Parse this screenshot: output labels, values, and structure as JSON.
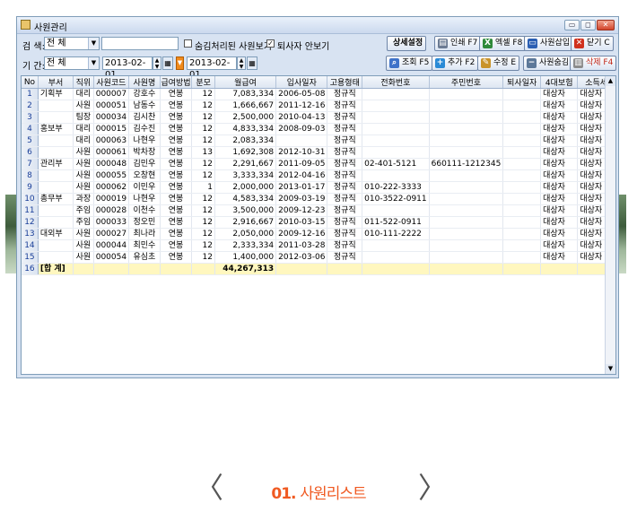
{
  "window": {
    "title": "사원관리",
    "minimize_glyph": "▭",
    "restore_glyph": "◻",
    "close_glyph": "✕"
  },
  "search": {
    "search_label": "검 색:",
    "search_scope": "전      체",
    "search_value": "",
    "retired_checkbox_label": "숨김처리된 사원보기",
    "retired_checked": false,
    "hide_quit_label": "퇴사자 안보기",
    "hide_quit_checked": true,
    "period_label": "기 간:",
    "period_scope": "전      체",
    "date_from": "2013-02-01",
    "date_to": "2013-02-01"
  },
  "toolbar": {
    "detail_settings": "상세설정",
    "print": "인쇄 F7",
    "excel": "엑셀 F8",
    "employee_register": "사원삽입",
    "close": "닫기 C",
    "query": "조회 F5",
    "add": "추가 F2",
    "edit": "수정 E",
    "employee_hide": "사원숨김",
    "delete": "삭제 F4"
  },
  "icons": {
    "print": "printer-icon",
    "excel": "excel-icon",
    "register": "user-icon",
    "close": "x-icon",
    "query": "magnifier-icon",
    "add": "plus-icon",
    "edit": "pencil-icon",
    "hide": "minus-icon",
    "delete": "trash-icon"
  },
  "colors": {
    "accent": "#f05a22",
    "total_row": "#fff7bf",
    "row_number": "#1a3f99"
  },
  "grid": {
    "columns": [
      "No",
      "부서",
      "직위",
      "사원코드",
      "사원명",
      "급여방법",
      "분모",
      "월급여",
      "입사일자",
      "고용형태",
      "전화번호",
      "주민번호",
      "퇴사일자",
      "4대보험",
      "소득세"
    ],
    "rows": [
      [
        "1",
        "기획부",
        "대리",
        "000007",
        "강호수",
        "연봉",
        "12",
        "7,083,334",
        "2006-05-08",
        "정규직",
        "",
        "",
        "",
        "대상자",
        "대상자"
      ],
      [
        "2",
        "",
        "사원",
        "000051",
        "남동수",
        "연봉",
        "12",
        "1,666,667",
        "2011-12-16",
        "정규직",
        "",
        "",
        "",
        "대상자",
        "대상자"
      ],
      [
        "3",
        "",
        "팀장",
        "000034",
        "김시찬",
        "연봉",
        "12",
        "2,500,000",
        "2010-04-13",
        "정규직",
        "",
        "",
        "",
        "대상자",
        "대상자"
      ],
      [
        "4",
        "홍보부",
        "대리",
        "000015",
        "김수진",
        "연봉",
        "12",
        "4,833,334",
        "2008-09-03",
        "정규직",
        "",
        "",
        "",
        "대상자",
        "대상자"
      ],
      [
        "5",
        "",
        "대리",
        "000063",
        "나현우",
        "연봉",
        "12",
        "2,083,334",
        "",
        "정규직",
        "",
        "",
        "",
        "대상자",
        "대상자"
      ],
      [
        "6",
        "",
        "사원",
        "000061",
        "박차장",
        "연봉",
        "13",
        "1,692,308",
        "2012-10-31",
        "정규직",
        "",
        "",
        "",
        "대상자",
        "대상자"
      ],
      [
        "7",
        "관리부",
        "사원",
        "000048",
        "김민우",
        "연봉",
        "12",
        "2,291,667",
        "2011-09-05",
        "정규직",
        "02-401-5121",
        "660111-1212345",
        "",
        "대상자",
        "대상자"
      ],
      [
        "8",
        "",
        "사원",
        "000055",
        "오창현",
        "연봉",
        "12",
        "3,333,334",
        "2012-04-16",
        "정규직",
        "",
        "",
        "",
        "대상자",
        "대상자"
      ],
      [
        "9",
        "",
        "사원",
        "000062",
        "이민우",
        "연봉",
        "1",
        "2,000,000",
        "2013-01-17",
        "정규직",
        "010-222-3333",
        "",
        "",
        "대상자",
        "대상자"
      ],
      [
        "10",
        "총무부",
        "과장",
        "000019",
        "나현우",
        "연봉",
        "12",
        "4,583,334",
        "2009-03-19",
        "정규직",
        "010-3522-0911",
        "",
        "",
        "대상자",
        "대상자"
      ],
      [
        "11",
        "",
        "주임",
        "000028",
        "이천수",
        "연봉",
        "12",
        "3,500,000",
        "2009-12-23",
        "정규직",
        "",
        "",
        "",
        "대상자",
        "대상자"
      ],
      [
        "12",
        "",
        "주임",
        "000033",
        "정오민",
        "연봉",
        "12",
        "2,916,667",
        "2010-03-15",
        "정규직",
        "011-522-0911",
        "",
        "",
        "대상자",
        "대상자"
      ],
      [
        "13",
        "대외부",
        "사원",
        "000027",
        "최나라",
        "연봉",
        "12",
        "2,050,000",
        "2009-12-16",
        "정규직",
        "010-111-2222",
        "",
        "",
        "대상자",
        "대상자"
      ],
      [
        "14",
        "",
        "사원",
        "000044",
        "최민수",
        "연봉",
        "12",
        "2,333,334",
        "2011-03-28",
        "정규직",
        "",
        "",
        "",
        "대상자",
        "대상자"
      ],
      [
        "15",
        "",
        "사원",
        "000054",
        "유심초",
        "연봉",
        "12",
        "1,400,000",
        "2012-03-06",
        "정규직",
        "",
        "",
        "",
        "대상자",
        "대상자"
      ]
    ],
    "total": {
      "no": "16",
      "label": "[합 계]",
      "monthly_total": "44,267,313"
    }
  },
  "caption": {
    "number": "01.",
    "title": "사원리스트",
    "prev_glyph": "〈",
    "next_glyph": "〉"
  }
}
